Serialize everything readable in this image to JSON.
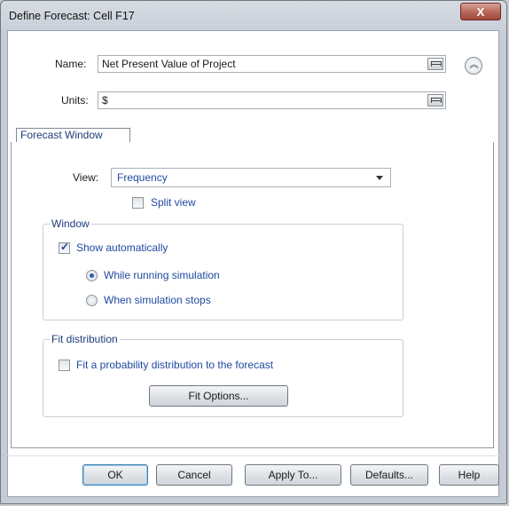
{
  "window": {
    "title": "Define Forecast: Cell F17",
    "close_label": "X"
  },
  "fields": {
    "name_label": "Name:",
    "name_value": "Net Present Value of Project",
    "units_label": "Units:",
    "units_value": "$"
  },
  "tabs": [
    {
      "label": "Forecast Window",
      "active": true
    }
  ],
  "view": {
    "label": "View:",
    "selected": "Frequency",
    "split_view_label": "Split view",
    "split_view_checked": false
  },
  "window_group": {
    "title": "Window",
    "show_automatically_label": "Show automatically",
    "show_automatically_checked": true,
    "radios": [
      {
        "label": "While running simulation",
        "checked": true
      },
      {
        "label": "When simulation stops",
        "checked": false
      }
    ]
  },
  "fit_group": {
    "title": "Fit distribution",
    "fit_checkbox_label": "Fit a probability distribution to the forecast",
    "fit_checked": false,
    "fit_options_label": "Fit Options..."
  },
  "buttons": {
    "ok": "OK",
    "cancel": "Cancel",
    "apply_to": "Apply To...",
    "defaults": "Defaults...",
    "help": "Help"
  },
  "colors": {
    "accent": "#1f4aa0",
    "title_close": "#b96a5c"
  },
  "icons": [
    "browse-icon",
    "collapse-icon",
    "dropdown-caret-icon",
    "close-icon"
  ]
}
